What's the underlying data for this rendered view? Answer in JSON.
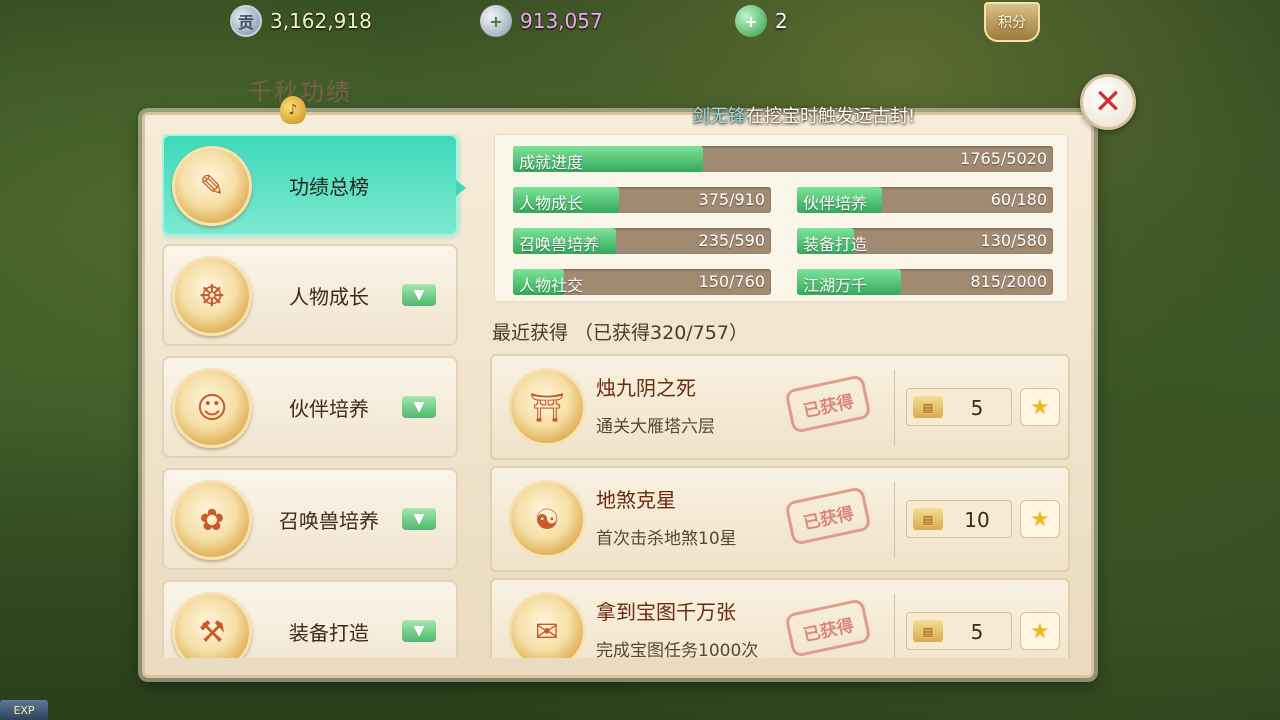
{
  "currencies": {
    "contribution": {
      "icon": "贡",
      "value": "3,162,918"
    },
    "silver": {
      "icon": "+",
      "value": "913,057"
    },
    "jade": {
      "icon": "+",
      "value": "2"
    },
    "score_label": "积分"
  },
  "panel": {
    "title": "千秋功绩",
    "marquee": {
      "player": "剑无锋",
      "text": "在挖宝时触发远古封!"
    }
  },
  "nav": [
    {
      "label": "功绩总榜",
      "icon": "scroll",
      "active": true
    },
    {
      "label": "人物成长",
      "icon": "figure",
      "active": false
    },
    {
      "label": "伙伴培养",
      "icon": "companion",
      "active": false
    },
    {
      "label": "召唤兽培养",
      "icon": "beast",
      "active": false
    },
    {
      "label": "装备打造",
      "icon": "equipment",
      "active": false
    }
  ],
  "progress": {
    "overall": {
      "name": "成就进度",
      "current": 1765,
      "total": 5020,
      "text": "1765/5020"
    },
    "categories": [
      {
        "name": "人物成长",
        "current": 375,
        "total": 910,
        "text": "375/910"
      },
      {
        "name": "伙伴培养",
        "current": 60,
        "total": 180,
        "text": "60/180"
      },
      {
        "name": "召唤兽培养",
        "current": 235,
        "total": 590,
        "text": "235/590"
      },
      {
        "name": "装备打造",
        "current": 130,
        "total": 580,
        "text": "130/580"
      },
      {
        "name": "人物社交",
        "current": 150,
        "total": 760,
        "text": "150/760"
      },
      {
        "name": "江湖万千",
        "current": 815,
        "total": 2000,
        "text": "815/2000"
      }
    ]
  },
  "recent": {
    "title": "最近获得 （已获得320/757）",
    "items": [
      {
        "title": "烛九阴之死",
        "desc": "通关大雁塔六层",
        "stamp": "已获得",
        "reward_icon": "scroll-icon",
        "reward": "5"
      },
      {
        "title": "地煞克星",
        "desc": "首次击杀地煞10星",
        "stamp": "已获得",
        "reward_icon": "scroll-icon",
        "reward": "10"
      },
      {
        "title": "拿到宝图千万张",
        "desc": "完成宝图任务1000次",
        "stamp": "已获得",
        "reward_icon": "scroll-icon",
        "reward": "5"
      }
    ]
  },
  "exp_label": "EXP",
  "colors": {
    "accent": "#3ed8b9",
    "progress_fill": "#35a95a",
    "close": "#d0302e"
  }
}
